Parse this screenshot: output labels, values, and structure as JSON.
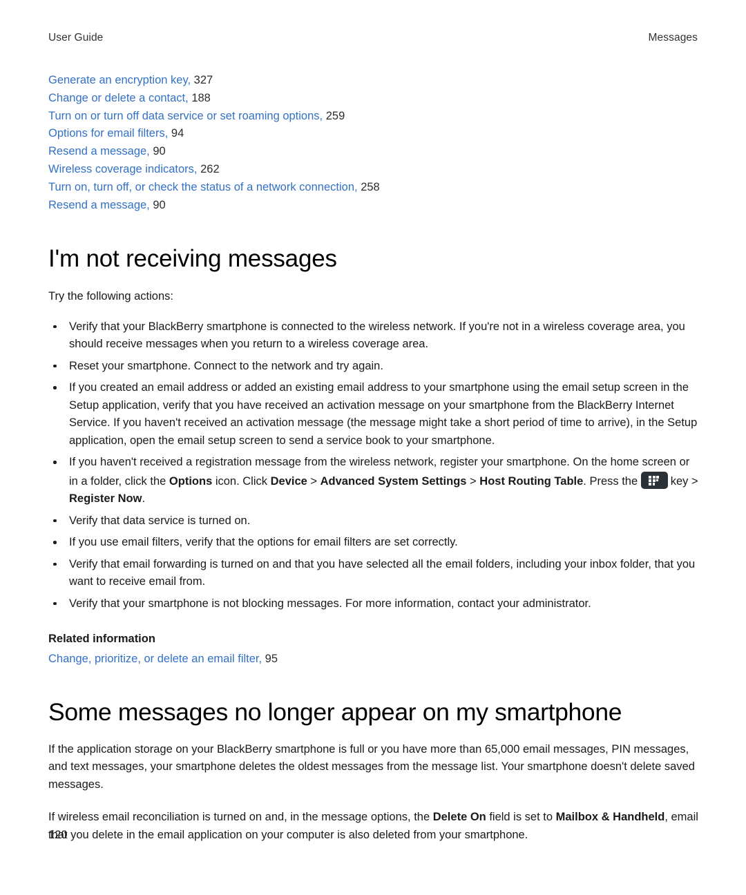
{
  "header": {
    "left": "User Guide",
    "right": "Messages"
  },
  "colors": {
    "link": "#3371c4",
    "text": "#1a1a1a",
    "key_icon_bg": "#2b3237"
  },
  "cross_references": [
    {
      "label": "Generate an encryption key,",
      "page": "327"
    },
    {
      "label": "Change or delete a contact,",
      "page": "188"
    },
    {
      "label": "Turn on or turn off data service or set roaming options,",
      "page": "259"
    },
    {
      "label": "Options for email filters,",
      "page": "94"
    },
    {
      "label": "Resend a message,",
      "page": "90"
    },
    {
      "label": "Wireless coverage indicators,",
      "page": "262"
    },
    {
      "label": "Turn on, turn off, or check the status of a network connection,",
      "page": "258"
    },
    {
      "label": "Resend a message,",
      "page": "90"
    }
  ],
  "section1": {
    "title": "I'm not receiving messages",
    "intro": "Try the following actions:",
    "bullets": {
      "b1": "Verify that your BlackBerry smartphone is connected to the wireless network. If you're not in a wireless coverage area, you should receive messages when you return to a wireless coverage area.",
      "b2": "Reset your smartphone. Connect to the network and try again.",
      "b3": "If you created an email address or added an existing email address to your smartphone using the email setup screen in the Setup application, verify that you have received an activation message on your smartphone from the BlackBerry Internet Service. If you haven't received an activation message (the message might take a short period of time to arrive), in the Setup application, open the email setup screen to send a service book to your smartphone.",
      "b4_part1": "If you haven't received a registration message from the wireless network, register your smartphone. On the home screen or in a folder, click the ",
      "b4_bold1": "Options",
      "b4_part2": " icon. Click ",
      "b4_bold2": "Device",
      "b4_sep1": " > ",
      "b4_bold3": "Advanced System Settings",
      "b4_sep2": " > ",
      "b4_bold4": "Host Routing Table",
      "b4_part3": ". Press the ",
      "b4_icon_label": "blackberry-menu-key",
      "b4_part4": "key > ",
      "b4_bold5": "Register Now",
      "b4_part5": ".",
      "b5": "Verify that data service is turned on.",
      "b6": "If you use email filters, verify that the options for email filters are set correctly.",
      "b7": "Verify that email forwarding is turned on and that you have selected all the email folders, including your inbox folder, that you want to receive email from.",
      "b8": "Verify that your smartphone is not blocking messages. For more information, contact your administrator."
    },
    "related_heading": "Related information",
    "related_link": {
      "label": "Change, prioritize, or delete an email filter,",
      "page": "95"
    }
  },
  "section2": {
    "title": "Some messages no longer appear on my smartphone",
    "para1": "If the application storage on your BlackBerry smartphone is full or you have more than 65,000 email messages, PIN messages, and text messages, your smartphone deletes the oldest messages from the message list. Your smartphone doesn't delete saved messages.",
    "para2_part1": "If wireless email reconciliation is turned on and, in the message options, the ",
    "para2_bold1": "Delete On",
    "para2_part2": " field is set to ",
    "para2_bold2": "Mailbox & Handheld",
    "para2_part3": ", email that you delete in the email application on your computer is also deleted from your smartphone."
  },
  "footer": {
    "page_number": "120"
  }
}
